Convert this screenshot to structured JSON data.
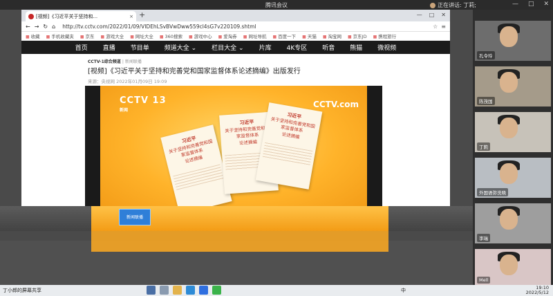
{
  "meeting": {
    "title": "腾讯会议",
    "speaking": "正在讲话: 丁莉;",
    "controls": [
      "—",
      "□",
      "✕"
    ]
  },
  "browser": {
    "tab_title": "[视频]《习近平关于坚持和...",
    "new_tab": "+",
    "window_controls": [
      "—",
      "□",
      "✕"
    ],
    "url": "http://tv.cctv.com/2022/01/09/VIDEhLSvBVwDww559cl4sG7v220109.shtml",
    "bookmarks": [
      "收藏",
      "手机收藏夹",
      "京东",
      "游戏大全",
      "网址大全",
      "360搜索",
      "游戏中心",
      "爱淘券",
      "网址导航",
      "百度一下",
      "天猫",
      "淘宝网",
      "京东JD",
      "携程旅行"
    ],
    "nav": [
      "首页",
      "直播",
      "节目单",
      "频道大全 ⌄",
      "栏目大全 ⌄",
      "片库",
      "4K专区",
      "听音",
      "熊猫",
      "微视频"
    ]
  },
  "article": {
    "crumb_channel": "CCTV-1综合频道",
    "crumb_program": "新闻联播",
    "headline": "[视频]《习近平关于坚持和完善党和国家监督体系论述摘编》出版发行",
    "meta": "来源：央视网  2022年01月09日 19:09"
  },
  "video": {
    "logo_left": "CCTV 13",
    "logo_left_sub": "新闻",
    "logo_right": "CCTV.com",
    "books": [
      {
        "author": "习近平",
        "title": "关于坚持和完善党和国家监督体系",
        "sub": "论述摘编"
      },
      {
        "author": "习近平",
        "title": "关于坚持和完善党和国家监督体系",
        "sub": "论述摘编"
      },
      {
        "author": "习近平",
        "title": "关于坚持和完善党和国家监督体系",
        "sub": "论述摘编"
      }
    ],
    "bottom_logo": "新闻联播"
  },
  "participants": [
    {
      "name": "孔令玲"
    },
    {
      "name": "陈茂国"
    },
    {
      "name": "丁莉"
    },
    {
      "name": "外国语弥洗晓"
    },
    {
      "name": "李瑞"
    },
    {
      "name": "Mell"
    }
  ],
  "taskbar": {
    "left": "丁小郎的屏幕共享",
    "ime": "中",
    "time": "19:10",
    "date": "2022/5/12"
  }
}
